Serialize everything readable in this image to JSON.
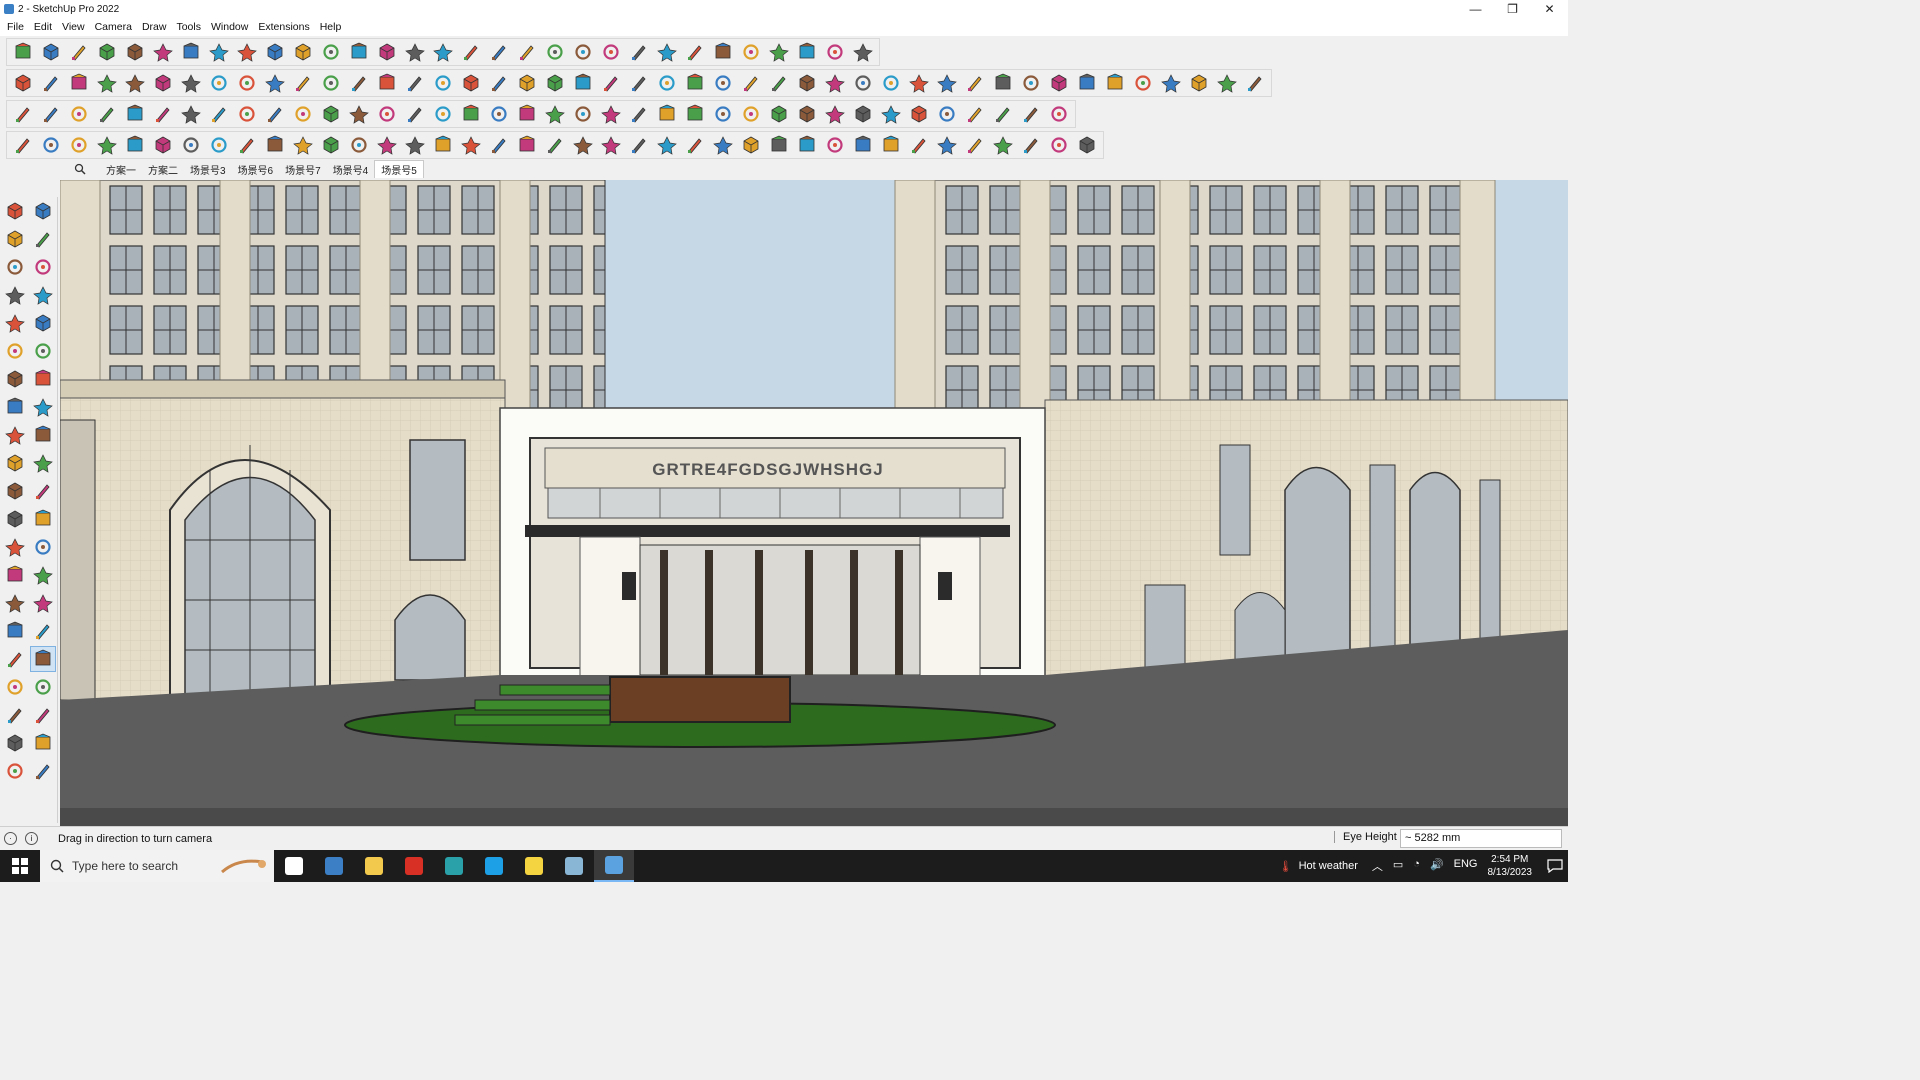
{
  "window": {
    "title": "2 - SketchUp Pro 2022",
    "controls": {
      "minimize": "—",
      "restore": "❐",
      "close": "✕"
    }
  },
  "menu": [
    "File",
    "Edit",
    "View",
    "Camera",
    "Draw",
    "Tools",
    "Window",
    "Extensions",
    "Help"
  ],
  "toolbars": {
    "row1": [
      "zoom",
      "select",
      "eraser",
      "pencil",
      "arc",
      "rectangle",
      "push-pull",
      "follow-me",
      "move",
      "rotate",
      "scale",
      "tape",
      "text",
      "paint",
      "orbit",
      "pan",
      "zoom-window",
      "zoom-extents",
      "sections",
      "layers",
      "tags",
      "styles",
      "user",
      "components",
      "materials",
      "axes",
      "dimensions",
      "solid",
      "undo",
      "redo",
      "stop"
    ],
    "row2": [
      "box-iso",
      "box-front",
      "box-top",
      "push-orange",
      "blue-arrow",
      "red-arrow",
      "green-arrow",
      "orange-arrow-n",
      "orange-arrow-x",
      "pink-arrow",
      "ring",
      "section-1",
      "section-2",
      "section-3",
      "green-plane",
      "green-star",
      "shed",
      "book",
      "home",
      "garage",
      "house",
      "shop",
      "fx",
      "hand",
      "pen",
      "rect-o",
      "circle-o",
      "polygon-o",
      "ellipse",
      "parallelogram",
      "arc-o",
      "spline",
      "curve",
      "freeform",
      "plugin-a",
      "plugin-b",
      "tool-red",
      "tool-pink",
      "roof",
      "brick",
      "door",
      "chair",
      "sofa",
      "bed",
      "stairs"
    ],
    "row3": [
      "plane-blue",
      "plane-blue2",
      "plane-yellow",
      "plane-green",
      "plane-red",
      "plane-grey",
      "undo-orange",
      "red-square",
      "split",
      "box-frame",
      "wood",
      "link",
      "corner",
      "dots-path",
      "plus-red",
      "plus-green",
      "cross-blue",
      "cone",
      "fountain",
      "triangle",
      "lasso",
      "knot",
      "ring2",
      "move-blue",
      "cup",
      "redo-red",
      "green-grid",
      "cubes",
      "cube-red",
      "cube-mix",
      "gear",
      "grid-a",
      "grid-b",
      "grid-c",
      "grid-d",
      "dots",
      "curve-pt",
      "matrix"
    ],
    "row4": [
      "line-pt",
      "dots-line",
      "vehicle",
      "scissors",
      "gear-outline",
      "gear2",
      "spiral",
      "shape-a",
      "shape-b",
      "hook",
      "stairs-a",
      "stairs-b",
      "stairs-c",
      "wedge",
      "arch",
      "cylinder",
      "columns",
      "comb",
      "tent",
      "drop",
      "fan",
      "rails",
      "slope",
      "steps",
      "truss",
      "steps2",
      "steps3",
      "stripes",
      "block",
      "step4",
      "fence",
      "grid-e",
      "lattice",
      "rails2",
      "lattice2",
      "wedge2",
      "sphere",
      "spiral2",
      "cube-tilt"
    ]
  },
  "scenes": {
    "tabs": [
      "方案一",
      "方案二",
      "场景号3",
      "场景号6",
      "场景号7",
      "场景号4",
      "场景号5"
    ],
    "active_index": 6
  },
  "left_tools": [
    "select",
    "orbit-lasso",
    "paint",
    "eraser",
    "cube-3d",
    "tape",
    "line",
    "freehand",
    "rectangle",
    "rotated-rect",
    "circle",
    "polygon",
    "arc",
    "arc-2pt",
    "pie",
    "arc-3pt",
    "move",
    "push-pull",
    "rotate",
    "follow-me",
    "scale",
    "offset",
    "tape-measure",
    "text",
    "protractor",
    "dimension",
    "axes",
    "3d-text",
    "orbit",
    "pan",
    "zoom",
    "zoom-window",
    "zoom-extents",
    "previous",
    "walk",
    "look-around",
    "footprints",
    "position-camera",
    "section-plane",
    "section-tools",
    "layers",
    "outliner"
  ],
  "viewport": {
    "facade_sign": "GRTRE4FGDSGJWHSHGJ",
    "sky_color": "#c6d7e6",
    "stone_color": "#e8dfcb"
  },
  "status": {
    "message": "Drag in direction to turn camera",
    "vcb_label": "Eye Height",
    "vcb_value": "~ 5282 mm"
  },
  "taskbar": {
    "search_placeholder": "Type here to search",
    "weather": "Hot weather",
    "language": "ENG",
    "time": "2:54 PM",
    "date": "8/13/2023",
    "apps": [
      "task-view",
      "calculator",
      "file-explorer",
      "acrobat",
      "3ds-max",
      "edge",
      "sticky-notes",
      "layout",
      "sketchup"
    ]
  }
}
